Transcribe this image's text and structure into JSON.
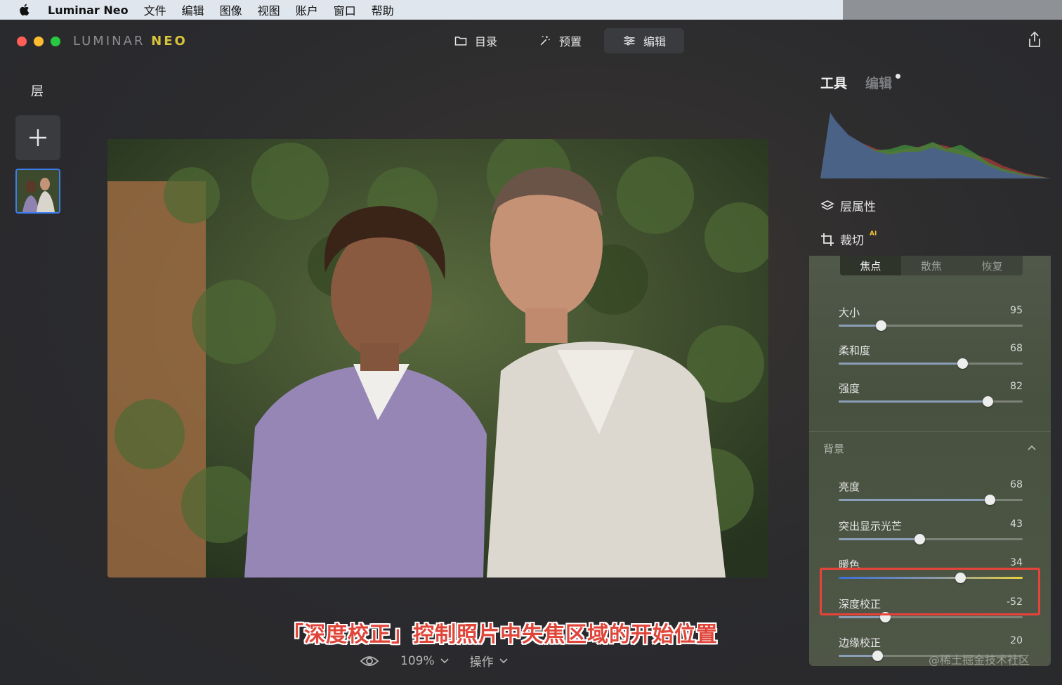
{
  "menubar": {
    "app_name": "Luminar Neo",
    "items": [
      "文件",
      "编辑",
      "图像",
      "视图",
      "账户",
      "窗口",
      "帮助"
    ]
  },
  "window": {
    "logo_text": "LUMINAR",
    "logo_accent": "NEO",
    "nav": [
      {
        "label": "目录",
        "icon": "folder-icon"
      },
      {
        "label": "预置",
        "icon": "magic-wand-icon"
      },
      {
        "label": "编辑",
        "icon": "sliders-icon",
        "active": true
      }
    ]
  },
  "layers": {
    "title": "层"
  },
  "caption": "「深度校正」控制照片中失焦区域的开始位置",
  "bottom_bar": {
    "zoom": "109%",
    "actions": "操作"
  },
  "right_panel": {
    "tab_tools": "工具",
    "tab_edits": "编辑",
    "layer_props": "层属性",
    "crop": "裁切",
    "crop_badge": "AI",
    "segments": [
      "焦点",
      "散焦",
      "恢复"
    ],
    "sliders_focus": [
      {
        "label": "大小",
        "value": "95",
        "pos": 0.23
      },
      {
        "label": "柔和度",
        "value": "68",
        "pos": 0.67
      },
      {
        "label": "强度",
        "value": "82",
        "pos": 0.81
      }
    ],
    "background_title": "背景",
    "sliders_background": [
      {
        "label": "亮度",
        "value": "68",
        "pos": 0.82
      },
      {
        "label": "突出显示光芒",
        "value": "43",
        "pos": 0.44
      },
      {
        "label": "暖色",
        "value": "34",
        "pos": 0.66
      },
      {
        "label": "深度校正",
        "value": "-52",
        "pos": 0.25
      },
      {
        "label": "边缘校正",
        "value": "20",
        "pos": 0.21
      }
    ]
  },
  "watermark": "@稀土掘金技术社区",
  "colors": {
    "accent_blue": "#3b7ef0",
    "highlight_red": "#e8433a",
    "logo_yellow": "#d8c23b"
  }
}
